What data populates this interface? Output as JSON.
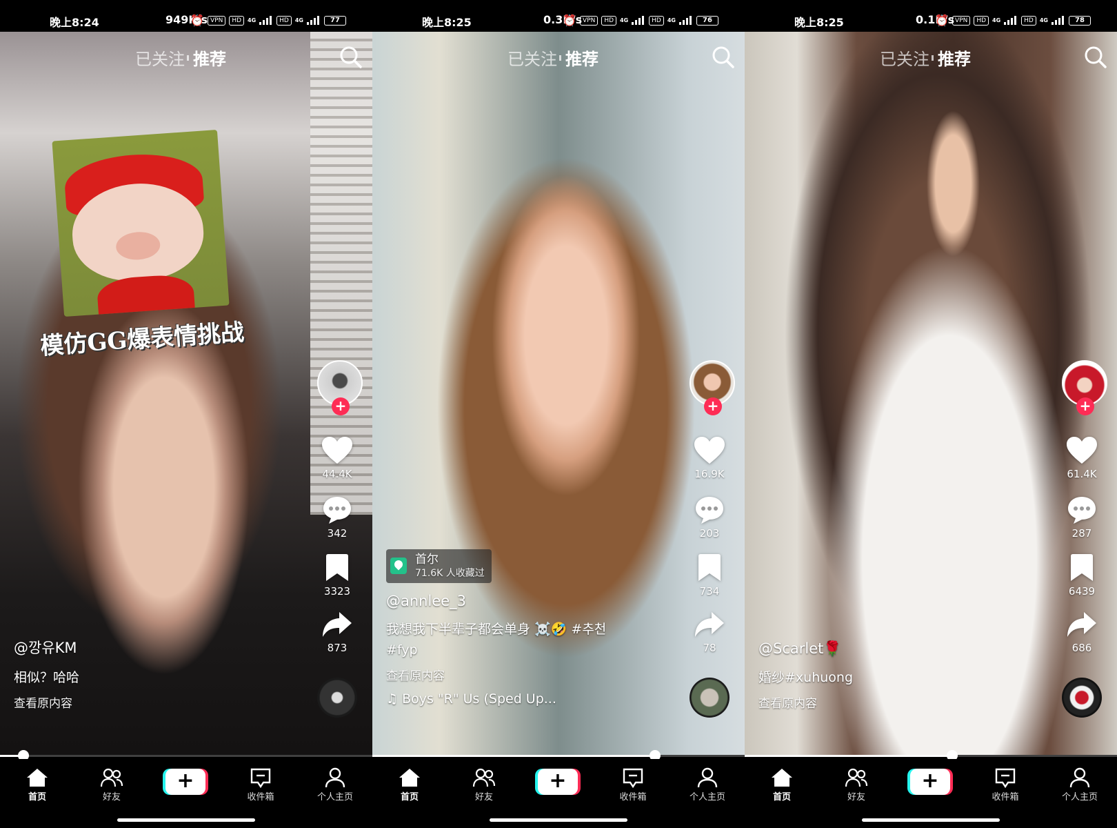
{
  "screens": [
    {
      "status": {
        "time": "晚上8:24",
        "speed": "949K/s",
        "vpn": "VPN",
        "hd1": "HD",
        "net1": "4G",
        "hd2": "HD",
        "net2": "4G",
        "battery": "77"
      },
      "nav": {
        "follow": "已关注",
        "recommend": "推荐"
      },
      "sticker_caption": "模仿GG爆表情挑战",
      "actions": {
        "likes": "44.4K",
        "comments": "342",
        "favorites": "3323",
        "shares": "873"
      },
      "author": "@깡유KM",
      "description": "相似？哈哈",
      "view_original": "查看原内容",
      "progress": 0.063
    },
    {
      "status": {
        "time": "晚上8:25",
        "speed": "0.3K/s",
        "vpn": "VPN",
        "hd1": "HD",
        "net1": "4G",
        "hd2": "HD",
        "net2": "4G",
        "battery": "76"
      },
      "nav": {
        "follow": "已关注",
        "recommend": "推荐"
      },
      "location": {
        "name": "首尔",
        "sub": "71.6K 人收藏过"
      },
      "actions": {
        "likes": "16.9K",
        "comments": "203",
        "favorites": "734",
        "shares": "78"
      },
      "author": "@annlee_3",
      "description": "我想我下半辈子都会单身 ☠️🤣 #추천",
      "hashtag_line": "#fyp",
      "view_original": "查看原内容",
      "music": "♫ Boys \"R\" Us (Sped Up...",
      "progress": 0.76
    },
    {
      "status": {
        "time": "晚上8:25",
        "speed": "0.1K/s",
        "vpn": "VPN",
        "hd1": "HD",
        "net1": "4G",
        "hd2": "HD",
        "net2": "4G",
        "battery": "78"
      },
      "nav": {
        "follow": "已关注",
        "recommend": "推荐"
      },
      "actions": {
        "likes": "61.4K",
        "comments": "287",
        "favorites": "6439",
        "shares": "686"
      },
      "author": "@Scarlet🌹",
      "description": "婚纱#xuhuong",
      "view_original": "查看原内容",
      "progress": 0.557
    }
  ],
  "tabbar": {
    "home": "首页",
    "friends": "好友",
    "add": "+",
    "inbox": "收件箱",
    "profile": "个人主页"
  },
  "colors": {
    "accent_red": "#fe2c55",
    "accent_cyan": "#25f4ee",
    "location_green": "#23c18a"
  },
  "icons": [
    "search-icon",
    "heart-icon",
    "comment-icon",
    "bookmark-icon",
    "share-icon",
    "home-icon",
    "friends-icon",
    "inbox-icon",
    "profile-icon",
    "location-pin-icon"
  ]
}
